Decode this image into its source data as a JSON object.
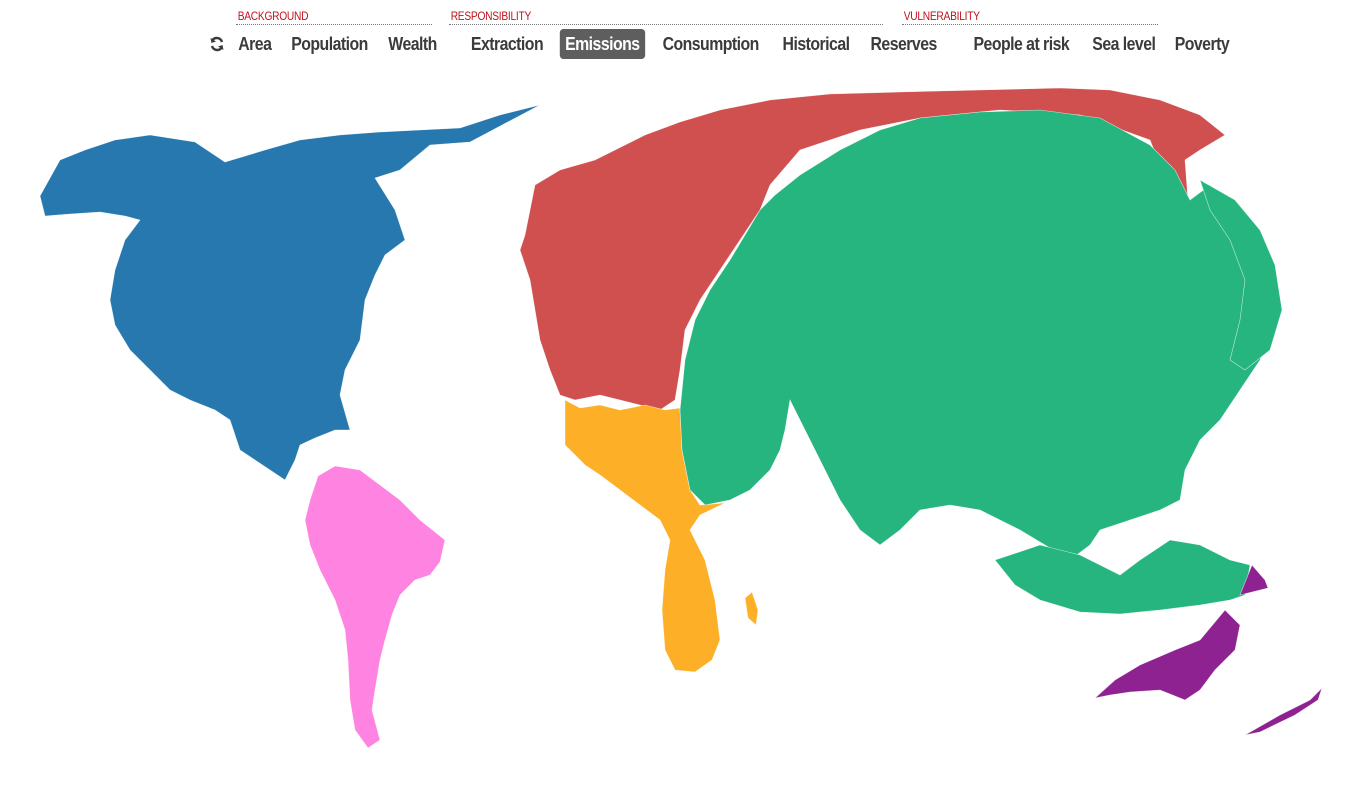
{
  "nav": {
    "refresh_icon": "refresh-icon",
    "groups": [
      {
        "label": "BACKGROUND",
        "items": [
          "Area",
          "Population",
          "Wealth"
        ]
      },
      {
        "label": "RESPONSIBILITY",
        "items": [
          "Extraction",
          "Emissions",
          "Consumption",
          "Historical",
          "Reserves"
        ]
      },
      {
        "label": "VULNERABILITY",
        "items": [
          "People at risk",
          "Sea level",
          "Poverty"
        ]
      }
    ],
    "active_item": "Emissions"
  },
  "map": {
    "type": "cartogram",
    "variable": "Emissions",
    "regions": [
      {
        "name": "North America",
        "color": "#2678ae"
      },
      {
        "name": "South America",
        "color": "#ff83e1"
      },
      {
        "name": "Europe",
        "color": "#d05050"
      },
      {
        "name": "Africa",
        "color": "#fdb027"
      },
      {
        "name": "Asia",
        "color": "#26b57f"
      },
      {
        "name": "Oceania",
        "color": "#8f2291"
      }
    ]
  }
}
